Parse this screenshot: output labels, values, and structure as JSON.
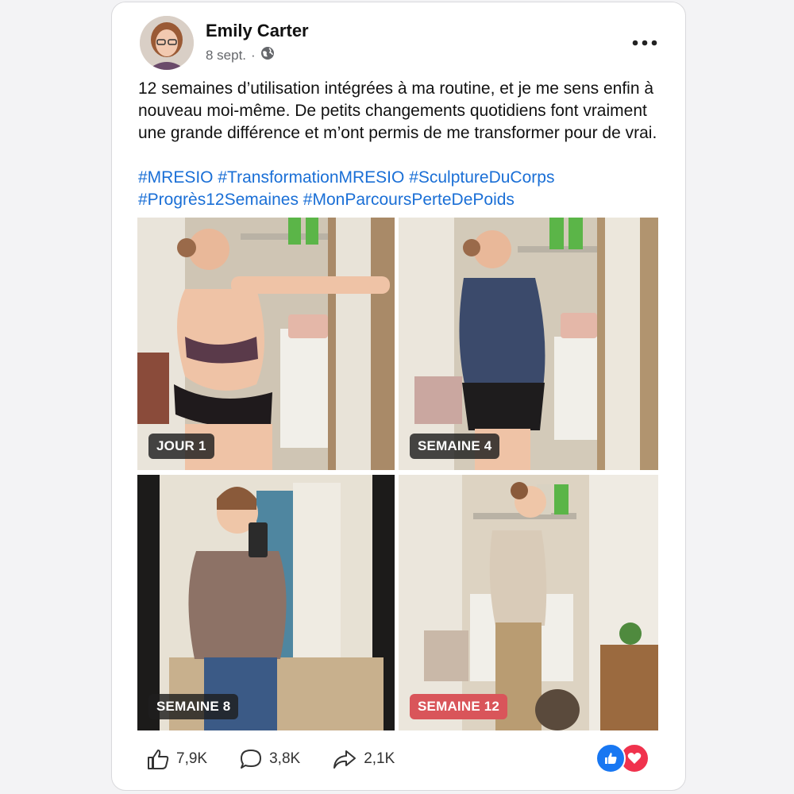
{
  "post": {
    "author": "Emily Carter",
    "date": "8 sept.",
    "separator": "·",
    "audience_icon": "globe-icon",
    "body": "12 semaines d’utilisation intégrées à ma routine, et je me sens enfin à nouveau moi-même. De petits changements quotidiens font vraiment une grande différence et m’ont permis de me transformer pour de vrai.",
    "hashtags": [
      "#MRESIO",
      "#TransformationMRESIO",
      "#SculptureDuCorps",
      "#Progrès12Semaines",
      "#MonParcoursPerteDePoids"
    ]
  },
  "photos": [
    {
      "label": "JOUR 1"
    },
    {
      "label": "SEMAINE 4"
    },
    {
      "label": "SEMAINE 8"
    },
    {
      "label": "SEMAINE 12"
    }
  ],
  "footer": {
    "likes": "7,9K",
    "comments": "3,8K",
    "shares": "2,1K"
  },
  "colors": {
    "link": "#1a6fd6",
    "like": "#1877f2",
    "love": "#f0324d",
    "badge_highlight": "#d9555a"
  }
}
